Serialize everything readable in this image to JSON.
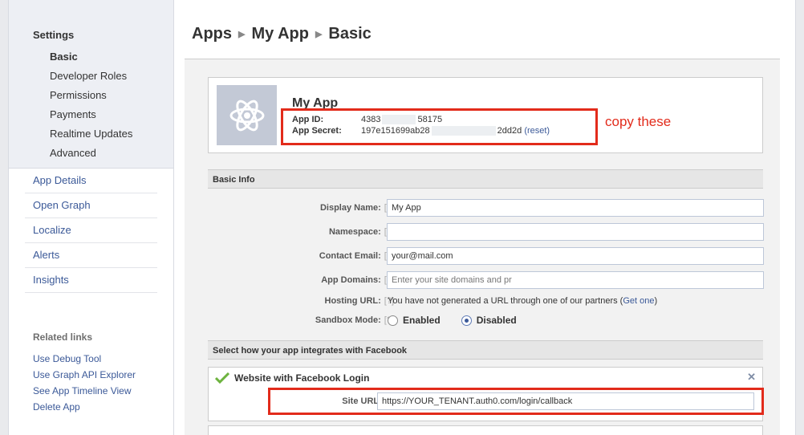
{
  "sidebar": {
    "settings_title": "Settings",
    "settings_items": [
      {
        "label": "Basic",
        "active": true
      },
      {
        "label": "Developer Roles"
      },
      {
        "label": "Permissions"
      },
      {
        "label": "Payments"
      },
      {
        "label": "Realtime Updates"
      },
      {
        "label": "Advanced"
      }
    ],
    "nav_items": [
      "App Details",
      "Open Graph",
      "Localize",
      "Alerts",
      "Insights"
    ],
    "related_title": "Related links",
    "related_items": [
      "Use Debug Tool",
      "Use Graph API Explorer",
      "See App Timeline View",
      "Delete App"
    ]
  },
  "breadcrumb": [
    "Apps",
    "My App",
    "Basic"
  ],
  "app": {
    "name": "My App",
    "id_label": "App ID:",
    "id_start": "4383",
    "id_end": "58175",
    "secret_label": "App Secret:",
    "secret_start": "197e151699ab28",
    "secret_end": "2dd2d",
    "reset_label": "(reset)"
  },
  "annotation": "copy these",
  "basic_info": {
    "header": "Basic Info",
    "help": "[?]",
    "display_name_label": "Display Name:",
    "display_name_value": "My App",
    "namespace_label": "Namespace:",
    "namespace_value": "",
    "contact_email_label": "Contact Email:",
    "contact_email_value": "your@mail.com",
    "app_domains_label": "App Domains:",
    "app_domains_placeholder": "Enter your site domains and pr",
    "hosting_url_label": "Hosting URL:",
    "hosting_url_text": "You have not generated a URL through one of our partners (",
    "hosting_url_link": "Get one",
    "hosting_url_close": ")",
    "sandbox_label": "Sandbox Mode:",
    "sandbox_options": [
      {
        "label": "Enabled",
        "selected": false
      },
      {
        "label": "Disabled",
        "selected": true
      }
    ]
  },
  "integration": {
    "header": "Select how your app integrates with Facebook",
    "website_title": "Website with Facebook Login",
    "close_icon": "✕",
    "site_url_label": "Site URL:",
    "site_url_value": "https://YOUR_TENANT.auth0.com/login/callback"
  },
  "colors": {
    "facebook_blue": "#3b5998",
    "annotation_red": "#e22b1b",
    "check_green": "#6db33f"
  }
}
